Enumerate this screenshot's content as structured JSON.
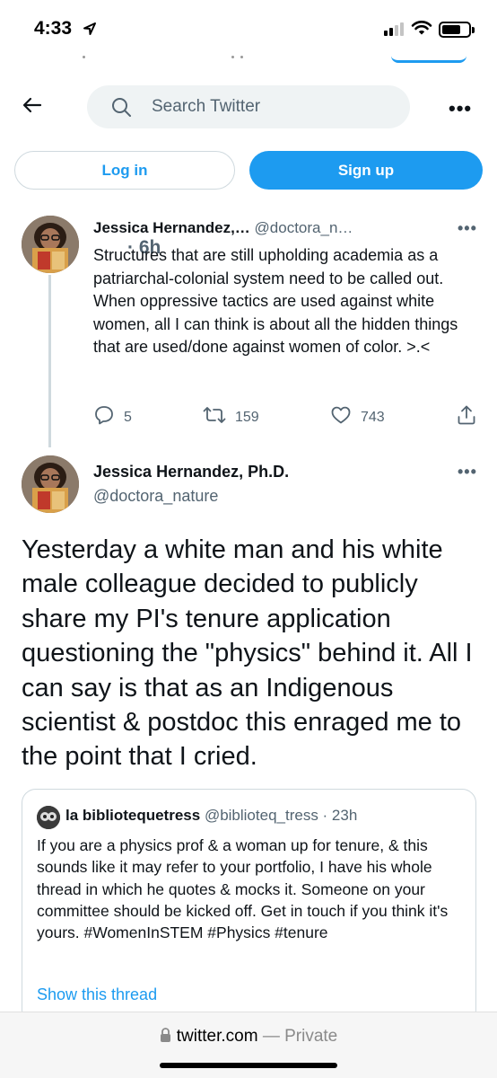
{
  "status_bar": {
    "time": "4:33"
  },
  "header": {
    "search_placeholder": "Search Twitter"
  },
  "auth": {
    "login_label": "Log in",
    "signup_label": "Sign up"
  },
  "tweet1": {
    "name": "Jessica Hernandez,…",
    "handle": "@doctora_n…",
    "time": "· 6h",
    "text": "Structures that are still upholding academia as a patriarchal-colonial system need to be called out.  When  oppressive tactics are used against white women, all I can think is about all the hidden things that are used/done against women of color. >.<",
    "replies": "5",
    "retweets": "159",
    "likes": "743"
  },
  "tweet2": {
    "name": "Jessica Hernandez, Ph.D.",
    "handle": "@doctora_nature",
    "text": "Yesterday a white man and his white male colleague decided to publicly share my PI's tenure application questioning the \"physics\" behind it. All I can say is that as an Indigenous scientist & postdoc this enraged me to the point that I cried."
  },
  "quote": {
    "name": "la bibliotequetress",
    "handle": "@biblioteq_tress · 23h",
    "text": "If you are a physics prof & a woman up for tenure, & this sounds like it may refer to your portfolio, I have his whole thread in which he quotes & mocks it. Someone on your committee should be kicked off. Get in touch if you think it's yours. #WomenInSTEM #Physics #tenure",
    "show_thread": "Show this thread"
  },
  "url_bar": {
    "domain": "twitter.com",
    "mode": "— Private"
  },
  "icons": [
    "location-arrow-icon",
    "signal-icon",
    "wifi-icon",
    "battery-icon",
    "back-arrow-icon",
    "search-icon",
    "more-icon",
    "reply-icon",
    "retweet-icon",
    "like-icon",
    "share-icon",
    "lock-icon"
  ],
  "colors": {
    "accent": "#1d9bf0",
    "secondary_text": "#536471",
    "border": "#cfd9de",
    "search_bg": "#eff3f4"
  }
}
